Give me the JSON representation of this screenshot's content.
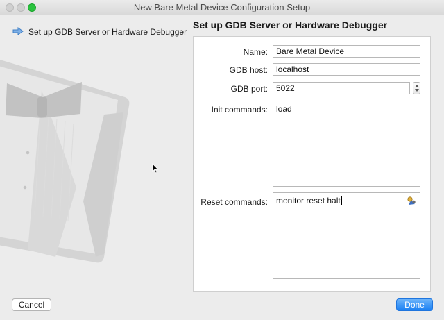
{
  "window": {
    "title": "New Bare Metal Device Configuration Setup"
  },
  "sidebar": {
    "steps": [
      {
        "label": "Set up GDB Server or Hardware Debugger",
        "active": true
      }
    ]
  },
  "main": {
    "heading": "Set up GDB Server or Hardware Debugger",
    "fields": {
      "name": {
        "label": "Name:",
        "value": "Bare Metal Device"
      },
      "gdb_host": {
        "label": "GDB host:",
        "value": "localhost"
      },
      "gdb_port": {
        "label": "GDB port:",
        "value": "5022"
      },
      "init_commands": {
        "label": "Init commands:",
        "value": "load"
      },
      "reset_commands": {
        "label": "Reset commands:",
        "value": "monitor reset halt"
      }
    }
  },
  "footer": {
    "cancel_label": "Cancel",
    "done_label": "Done"
  },
  "colors": {
    "accent": "#1b80f3",
    "zoom_button": "#2ac33f"
  },
  "icons": {
    "step_arrow": "arrow-right-icon",
    "reset_helper": "macro-helper-icon"
  }
}
